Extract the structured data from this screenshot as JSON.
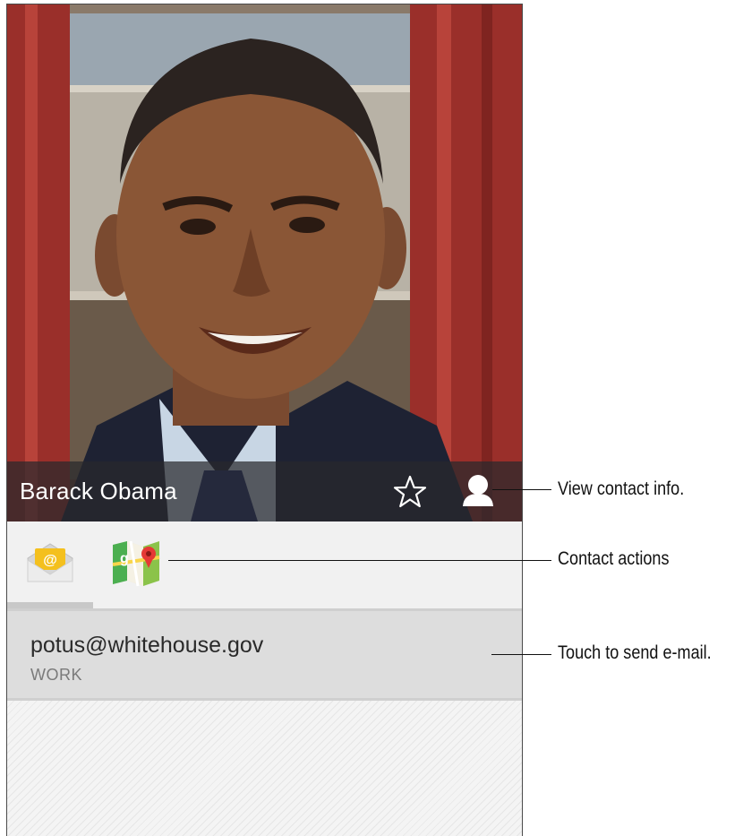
{
  "contact": {
    "name": "Barack Obama",
    "email": "potus@whitehouse.gov",
    "email_type": "WORK"
  },
  "icons": {
    "star": "star-outline-icon",
    "profile": "person-icon",
    "email_app": "email-envelope-icon",
    "maps_app": "maps-icon"
  },
  "callouts": {
    "view_contact": "View contact info.",
    "contact_actions": "Contact actions",
    "send_email": "Touch to send e-mail."
  },
  "colors": {
    "name_bar": "#28282c",
    "tab_bg": "#f1f1f1",
    "row_bg": "#dddddd"
  }
}
